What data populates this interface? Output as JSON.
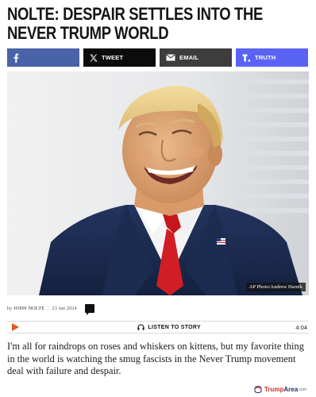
{
  "article": {
    "headline": "NOLTE: DESPAIR SETTLES INTO THE NEVER TRUMP WORLD",
    "photo_credit": "AP Photo/Andrew Harnik",
    "byline_prefix": "by",
    "author": "JOHN NOLTE",
    "date": "23 Jan 2024",
    "comment_count": "",
    "body": "I'm all for raindrops on roses and whiskers on kittens, but my favorite thing in the world is watching the smug fascists in the Never Trump movement deal with failure and despair."
  },
  "share": {
    "facebook_label": "",
    "tweet_label": "TWEET",
    "email_label": "EMAIL",
    "truth_label": "TRUTH",
    "colors": {
      "facebook": "#4a63a8",
      "tweet": "#0c0c0c",
      "email": "#3d3d3d",
      "truth": "#5a63f4"
    }
  },
  "audio": {
    "listen_label": "LISTEN TO STORY",
    "duration": "4:04",
    "play_color": "#e4571d",
    "icons": {
      "play": "play-icon",
      "listen": "headphones-icon"
    }
  },
  "watermark": {
    "brand_a": "Trump",
    "brand_b": "Area",
    "suffix": ".com"
  }
}
